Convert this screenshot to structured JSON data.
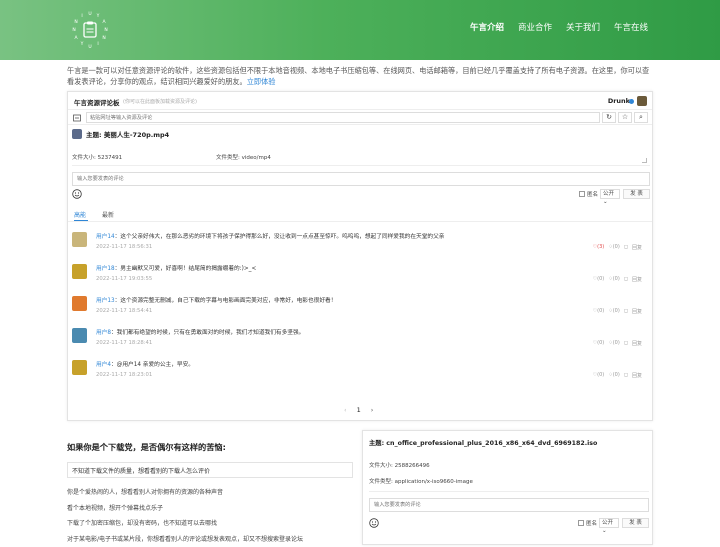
{
  "brand": {
    "logo_letters": "NIUYANNIUYAN"
  },
  "nav": {
    "items": [
      {
        "label": "午言介绍",
        "active": true
      },
      {
        "label": "商业合作",
        "active": false
      },
      {
        "label": "关于我们",
        "active": false
      },
      {
        "label": "午言在线",
        "active": false
      }
    ]
  },
  "intro": {
    "text": "午言是一款可以对任意资源评论的软件，这些资源包括但不限于本地音视频、本地电子书压缩包等、在线网页、电话邮箱等，目前已经几乎覆盖支持了所有电子资源。在这里，你可以查看发表评论，分享你的观点，结识相同兴趣爱好的朋友。",
    "link": "立即体验"
  },
  "panel": {
    "title": "午言资源评论板",
    "subtitle": "(你可以在此面板加载资源及评论)",
    "user": "Drunk",
    "search_placeholder": "粘贴网址等输入资源及评论",
    "topic": "主题: 美丽人生-720p.mp4",
    "file_size": "文件大小: 5237491",
    "file_type": "文件类型: video/mp4",
    "comment_placeholder": "输入您要发表的评论",
    "anon_label": "匿名",
    "visibility": "公开",
    "submit": "发 表",
    "tabs": [
      {
        "label": "高能",
        "active": true
      },
      {
        "label": "最新",
        "active": false
      }
    ],
    "comments": [
      {
        "user": "用户14",
        "text": "：这个父亲好伟大，在那么恶劣的环境下将孩子保护得那么好，没让收到一点点甚至惊吓。呜呜呜，想起了同样爱我的在天堂的父亲",
        "time": "2022-11-17 18:56:31",
        "likes": "(3)",
        "hot": true,
        "dislikes": "(0)",
        "reply": "回复",
        "avatar_color": "#c9b57a"
      },
      {
        "user": "用户18",
        "text": "：男主幽默又可爱，好喜啊！结尾简的揭露绷着的:)>_<",
        "time": "2022-11-17 19:03:55",
        "likes": "(0)",
        "hot": false,
        "dislikes": "(0)",
        "reply": "回复",
        "avatar_color": "#c7a12a"
      },
      {
        "user": "用户13",
        "text": "：这个资源完整无删减，自己下载的字幕与电影画面完美对应，非常好，电影也很好看！",
        "time": "2022-11-17 18:54:41",
        "likes": "(0)",
        "hot": false,
        "dislikes": "(0)",
        "reply": "回复",
        "avatar_color": "#e07a2e"
      },
      {
        "user": "用户8",
        "text": "：我们都有绝望的时候，只有在勇敢面对的时候，我们才知道我们有多坚强。",
        "time": "2022-11-17 18:28:41",
        "likes": "(0)",
        "hot": false,
        "dislikes": "(0)",
        "reply": "回复",
        "avatar_color": "#4a8ab0"
      },
      {
        "user": "用户4",
        "text": "：@用户14 亲爱的公主，早安。",
        "time": "2022-11-17 18:23:01",
        "likes": "(0)",
        "hot": false,
        "dislikes": "(0)",
        "reply": "回复",
        "avatar_color": "#c7a12a"
      }
    ],
    "pager": {
      "prev": "‹",
      "page": "1",
      "next": "›"
    }
  },
  "pain": {
    "title": "如果你是个下载党，是否偶尔有这样的苦恼:",
    "box": "不知道下载文件的质量，想看看别的下载人怎么评价",
    "lines": [
      "你是个爱热闹的人，想看看别人对你拥有的资源的各种声音",
      "看个本地视频，想开个弹幕找点乐子",
      "下载了个加密压缩包，却没有密码，也不知道可以去哪找",
      "对于某电影/电子书或某片段，你想看看别人的评论或想发表观点，却又不想搜索登录论坛"
    ]
  },
  "panel2": {
    "title": "主题: cn_office_professional_plus_2016_x86_x64_dvd_6969182.iso",
    "file_size": "文件大小: 2588266496",
    "file_type": "文件类型: application/x-iso9660-image",
    "comment_placeholder": "输入您要发表的评论",
    "anon_label": "匿名",
    "visibility": "公开",
    "submit": "发 表"
  }
}
